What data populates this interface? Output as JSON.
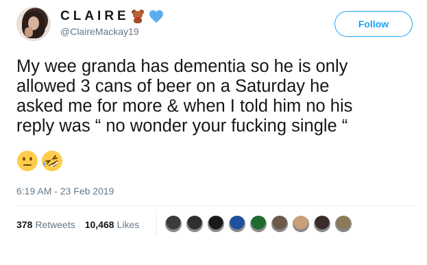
{
  "user": {
    "display_name": "CLAIRE",
    "name_emojis": [
      "teddy-bear-icon",
      "blue-heart-icon"
    ],
    "handle": "@ClaireMackay19",
    "avatar": "profile-photo"
  },
  "follow_button": {
    "label": "Follow"
  },
  "tweet": {
    "text": "My wee granda has dementia so he is only\nallowed 3 cans of beer on a Saturday he\nasked me for more & when I told him no his\nreply was “ no wonder your fucking single “",
    "emojis": [
      "neutral-face-icon",
      "rolling-on-floor-laughing-icon"
    ]
  },
  "timestamp": "6:19 AM - 23 Feb 2019",
  "stats": {
    "retweets_count": "378",
    "retweets_label": "Retweets",
    "likes_count": "10,468",
    "likes_label": "Likes"
  },
  "likers": {
    "avatar_colors": [
      "#3b3b3b",
      "#2e2e2e",
      "#1a1a1a",
      "#1e4fa0",
      "#1d6b2f",
      "#6b5a4a",
      "#c9a07a",
      "#3a2a2a",
      "#8a7a5a"
    ]
  },
  "colors": {
    "accent": "#1da1f2",
    "text_primary": "#14171a",
    "text_secondary": "#657786"
  }
}
